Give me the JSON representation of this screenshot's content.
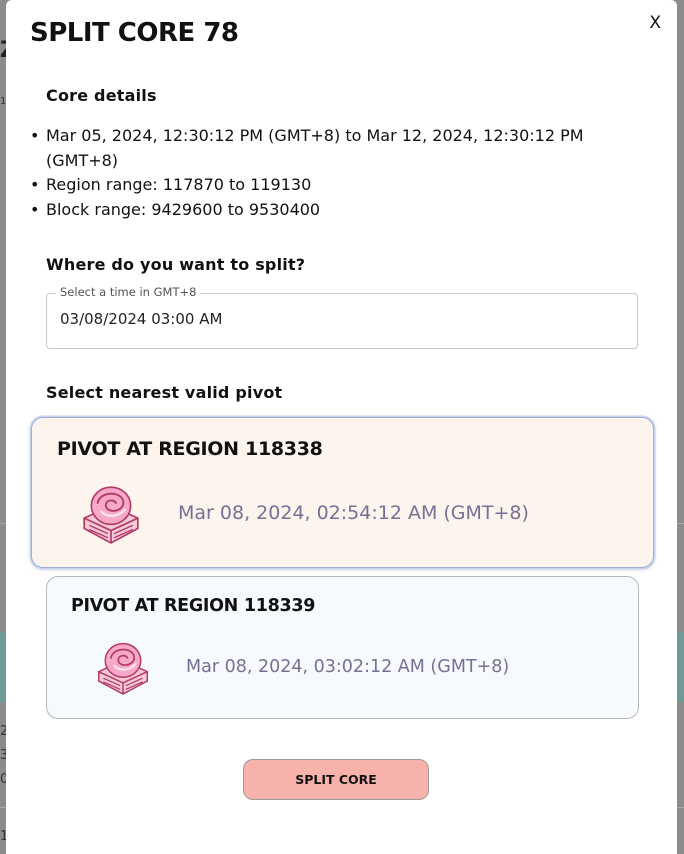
{
  "modal": {
    "title": "SPLIT CORE 78",
    "close_label": "X"
  },
  "core_details": {
    "heading": "Core details",
    "items": [
      "Mar 05, 2024, 12:30:12 PM (GMT+8) to Mar 12, 2024, 12:30:12 PM (GMT+8)",
      "Region range: 117870 to 119130",
      "Block range: 9429600 to 9530400"
    ]
  },
  "split_time": {
    "heading": "Where do you want to split?",
    "label": "Select a time in GMT+8",
    "value": "03/08/2024 03:00 AM"
  },
  "pivots": {
    "heading": "Select nearest valid pivot",
    "options": [
      {
        "title": "PIVOT AT REGION 118338",
        "time": "Mar 08, 2024, 02:54:12 AM (GMT+8)",
        "selected": true
      },
      {
        "title": "PIVOT AT REGION 118339",
        "time": "Mar 08, 2024, 03:02:12 AM (GMT+8)",
        "selected": false
      }
    ]
  },
  "actions": {
    "split_label": "SPLIT CORE"
  },
  "background_fragments": [
    "Z",
    "1",
    "2",
    "3",
    "0",
    "1"
  ],
  "colors": {
    "selected_pivot_bg": "#fef4ee",
    "unselected_pivot_bg": "#f6f9fd",
    "split_button_bg": "#f7b3ab",
    "pivot_time_text": "#7a6f93",
    "core_icon_pink": "#e7639c"
  },
  "icons": [
    "core-icon"
  ]
}
